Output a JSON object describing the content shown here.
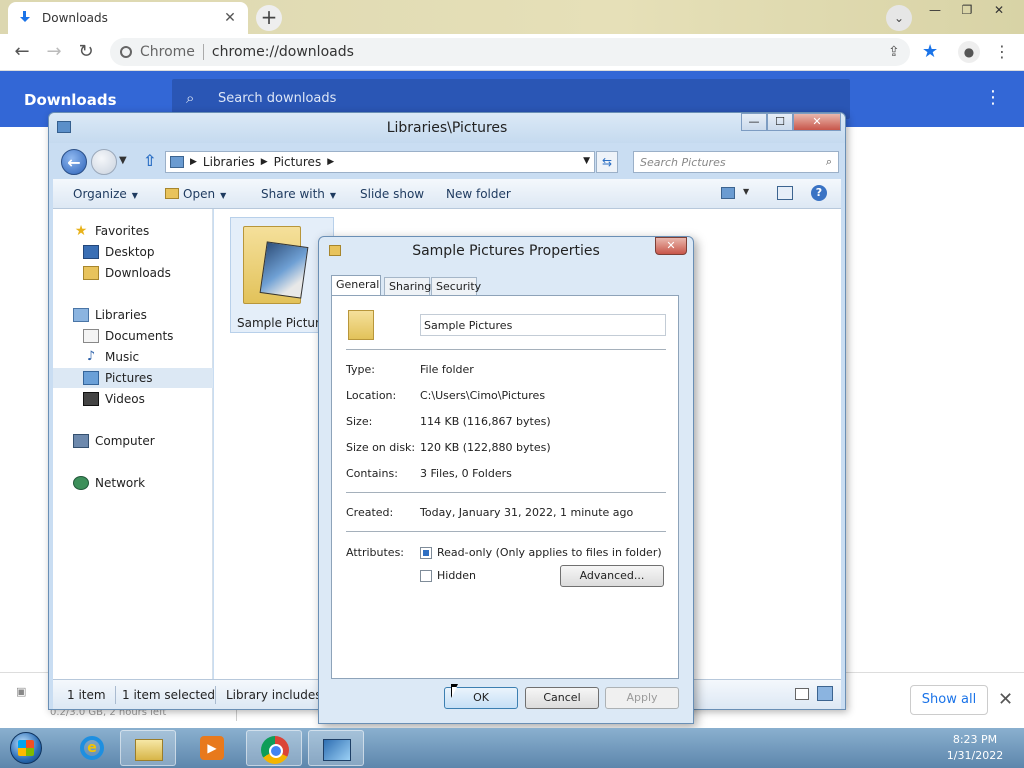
{
  "chrome": {
    "tab_title": "Downloads",
    "tab_close": "✕",
    "new_tab": "+",
    "window_controls": {
      "minimize": "—",
      "restore": "❐",
      "close": "✕"
    },
    "site_name": "Chrome",
    "url": "chrome://downloads",
    "accent_color": "#3367d6"
  },
  "downloads": {
    "title": "Downloads",
    "search_placeholder": "Search downloads",
    "shelf_item_sub": "0.2/3.0 GB, 2 hours left",
    "show_all": "Show all",
    "shelf_close": "✕"
  },
  "explorer": {
    "title": "Libraries\\Pictures",
    "window_controls": {
      "minimize": "—",
      "maximize": "☐",
      "close": "✕"
    },
    "breadcrumb": [
      "Libraries",
      "Pictures"
    ],
    "search_placeholder": "Search Pictures",
    "commands": {
      "organize": "Organize",
      "open": "Open",
      "share_with": "Share with",
      "slide_show": "Slide show",
      "new_folder": "New folder"
    },
    "nav": {
      "favorites": "Favorites",
      "desktop": "Desktop",
      "downloads": "Downloads",
      "libraries": "Libraries",
      "documents": "Documents",
      "music": "Music",
      "pictures": "Pictures",
      "videos": "Videos",
      "computer": "Computer",
      "network": "Network"
    },
    "folder_caption": "Sample Picture",
    "status": {
      "count": "1 item",
      "selected": "1 item selected",
      "library": "Library includes: 2"
    }
  },
  "properties": {
    "title": "Sample Pictures Properties",
    "close": "✕",
    "tabs": [
      "General",
      "Sharing",
      "Security"
    ],
    "folder_name": "Sample Pictures",
    "rows": {
      "type_label": "Type:",
      "type_value": "File folder",
      "location_label": "Location:",
      "location_value": "C:\\Users\\Cimo\\Pictures",
      "size_label": "Size:",
      "size_value": "114 KB (116,867 bytes)",
      "size_on_disk_label": "Size on disk:",
      "size_on_disk_value": "120 KB (122,880 bytes)",
      "contains_label": "Contains:",
      "contains_value": "3 Files, 0 Folders",
      "created_label": "Created:",
      "created_value": "Today, January 31, 2022, 1 minute ago",
      "attributes_label": "Attributes:"
    },
    "attributes": {
      "read_only": "Read-only (Only applies to files in folder)",
      "hidden": "Hidden",
      "advanced": "Advanced..."
    },
    "buttons": {
      "ok": "OK",
      "cancel": "Cancel",
      "apply": "Apply"
    }
  },
  "taskbar": {
    "time": "8:23 PM",
    "date": "1/31/2022"
  }
}
